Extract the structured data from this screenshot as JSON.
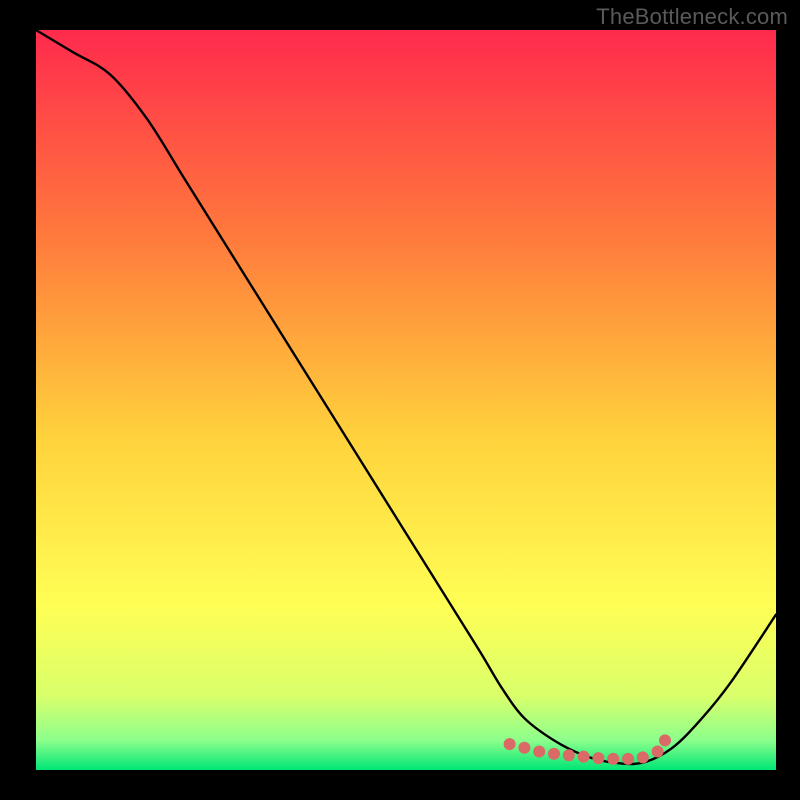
{
  "watermark": "TheBottleneck.com",
  "colors": {
    "background": "#000000",
    "gradient_top": "#ff2a4d",
    "gradient_mid1": "#ff7a3c",
    "gradient_mid2": "#ffd23c",
    "gradient_mid3": "#ffff55",
    "gradient_mid4": "#d9ff6b",
    "gradient_mid5": "#8cff8c",
    "gradient_bottom": "#00e676",
    "curve": "#000000",
    "dots": "#d96a66"
  },
  "plot": {
    "inner_x": 36,
    "inner_y": 30,
    "inner_w": 740,
    "inner_h": 740
  },
  "chart_data": {
    "type": "line",
    "title": "",
    "xlabel": "",
    "ylabel": "",
    "xlim": [
      0,
      100
    ],
    "ylim": [
      0,
      100
    ],
    "grid": false,
    "legend": false,
    "series": [
      {
        "name": "bottleneck-curve",
        "x": [
          0,
          5,
          10,
          15,
          20,
          25,
          30,
          35,
          40,
          45,
          50,
          55,
          60,
          63,
          66,
          70,
          74,
          78,
          82,
          86,
          90,
          94,
          100
        ],
        "y": [
          100,
          97,
          94,
          88,
          80,
          72,
          64,
          56,
          48,
          40,
          32,
          24,
          16,
          11,
          7,
          4,
          2,
          1,
          1,
          3,
          7,
          12,
          21
        ]
      }
    ],
    "dot_series": {
      "name": "valley-dots",
      "x": [
        64,
        66,
        68,
        70,
        72,
        74,
        76,
        78,
        80,
        82,
        84,
        85
      ],
      "y": [
        3.5,
        3,
        2.5,
        2.2,
        2,
        1.8,
        1.6,
        1.5,
        1.5,
        1.7,
        2.5,
        4
      ]
    }
  }
}
